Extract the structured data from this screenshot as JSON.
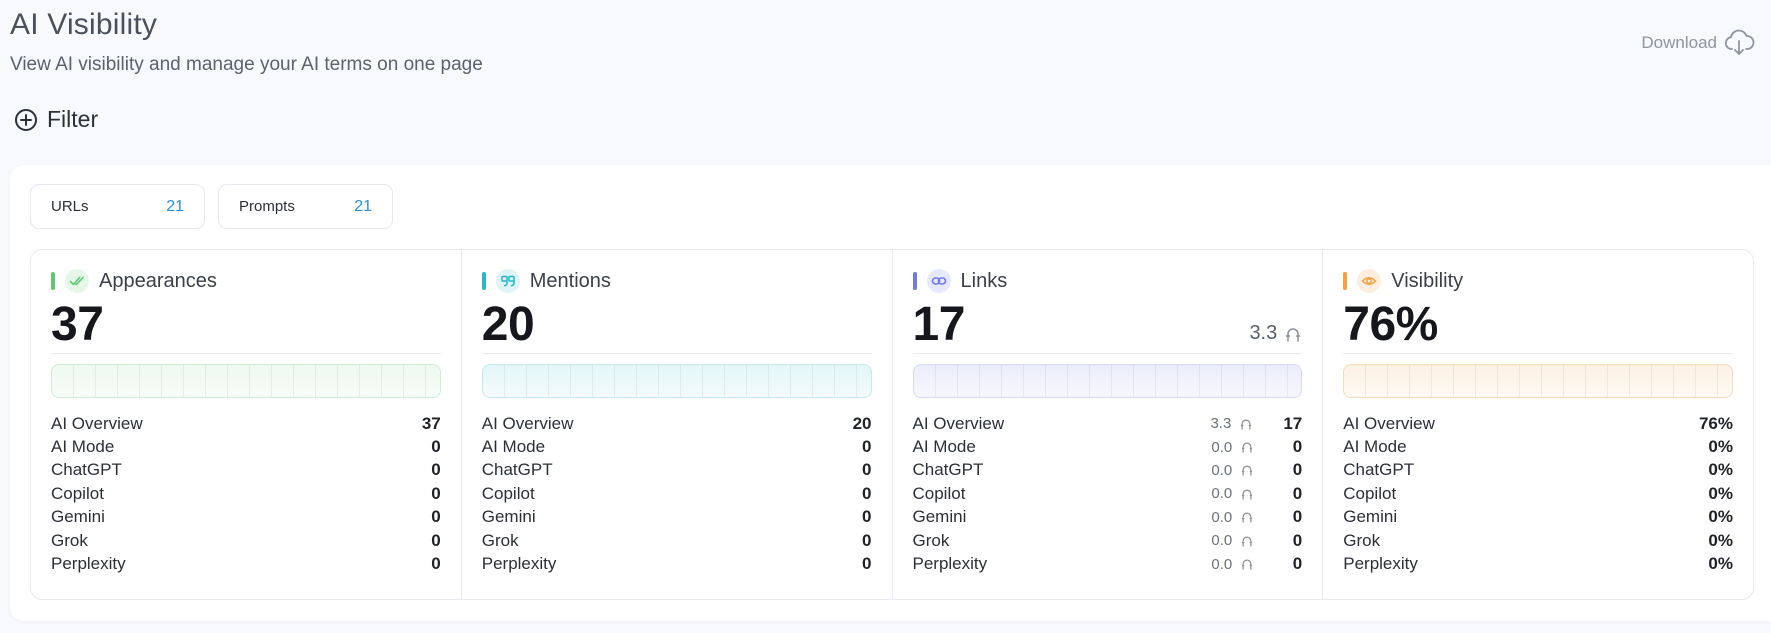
{
  "header": {
    "title": "AI Visibility",
    "subtitle": "View AI visibility and manage your AI terms on one page",
    "download_label": "Download"
  },
  "filter": {
    "label": "Filter"
  },
  "chips": [
    {
      "label": "URLs",
      "count": "21"
    },
    {
      "label": "Prompts",
      "count": "21"
    }
  ],
  "cards": {
    "appearances": {
      "title": "Appearances",
      "value": "37",
      "accent": "#5cc86f",
      "rows": [
        {
          "label": "AI Overview",
          "value": "37"
        },
        {
          "label": "AI Mode",
          "value": "0"
        },
        {
          "label": "ChatGPT",
          "value": "0"
        },
        {
          "label": "Copilot",
          "value": "0"
        },
        {
          "label": "Gemini",
          "value": "0"
        },
        {
          "label": "Grok",
          "value": "0"
        },
        {
          "label": "Perplexity",
          "value": "0"
        }
      ]
    },
    "mentions": {
      "title": "Mentions",
      "value": "20",
      "accent": "#26b8c8",
      "rows": [
        {
          "label": "AI Overview",
          "value": "20"
        },
        {
          "label": "AI Mode",
          "value": "0"
        },
        {
          "label": "ChatGPT",
          "value": "0"
        },
        {
          "label": "Copilot",
          "value": "0"
        },
        {
          "label": "Gemini",
          "value": "0"
        },
        {
          "label": "Grok",
          "value": "0"
        },
        {
          "label": "Perplexity",
          "value": "0"
        }
      ]
    },
    "links": {
      "title": "Links",
      "value": "17",
      "avg": "3.3",
      "accent": "#6f78e8",
      "rows": [
        {
          "label": "AI Overview",
          "avg": "3.3",
          "value": "17"
        },
        {
          "label": "AI Mode",
          "avg": "0.0",
          "value": "0"
        },
        {
          "label": "ChatGPT",
          "avg": "0.0",
          "value": "0"
        },
        {
          "label": "Copilot",
          "avg": "0.0",
          "value": "0"
        },
        {
          "label": "Gemini",
          "avg": "0.0",
          "value": "0"
        },
        {
          "label": "Grok",
          "avg": "0.0",
          "value": "0"
        },
        {
          "label": "Perplexity",
          "avg": "0.0",
          "value": "0"
        }
      ]
    },
    "visibility": {
      "title": "Visibility",
      "value": "76%",
      "accent": "#f5a043",
      "rows": [
        {
          "label": "AI Overview",
          "value": "76%"
        },
        {
          "label": "AI Mode",
          "value": "0%"
        },
        {
          "label": "ChatGPT",
          "value": "0%"
        },
        {
          "label": "Copilot",
          "value": "0%"
        },
        {
          "label": "Gemini",
          "value": "0%"
        },
        {
          "label": "Grok",
          "value": "0%"
        },
        {
          "label": "Perplexity",
          "value": "0%"
        }
      ]
    }
  },
  "icons": {
    "appearances": "double-check-icon",
    "mentions": "quote-icon",
    "links": "link-icon",
    "visibility": "eye-icon",
    "avg": "arch-icon",
    "download": "cloud-download-icon",
    "filter": "plus-circle-icon"
  }
}
